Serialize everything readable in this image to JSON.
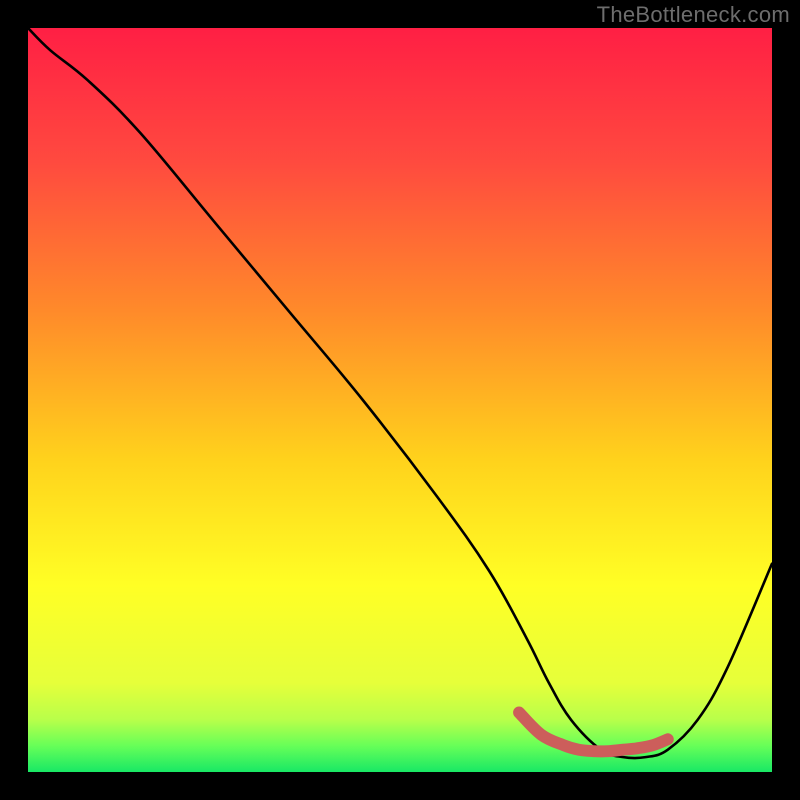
{
  "watermark": "TheBottleneck.com",
  "chart_data": {
    "type": "line",
    "title": "",
    "xlabel": "",
    "ylabel": "",
    "xlim": [
      0,
      100
    ],
    "ylim": [
      0,
      100
    ],
    "grid": false,
    "series": [
      {
        "name": "curve",
        "color": "#000000",
        "x": [
          0,
          3,
          8,
          15,
          25,
          35,
          45,
          55,
          62,
          67,
          70,
          73,
          77,
          80,
          83,
          86,
          90,
          94,
          100
        ],
        "values": [
          100,
          97,
          93,
          86,
          74,
          62,
          50,
          37,
          27,
          18,
          12,
          7,
          3,
          2,
          2,
          3,
          7,
          14,
          28
        ]
      }
    ],
    "highlight_band": {
      "comment": "red thick segment near minimum",
      "color": "#cc5e5b",
      "x": [
        66,
        69,
        72,
        74,
        76,
        78,
        80,
        82,
        84,
        86
      ],
      "values": [
        8,
        5,
        3.6,
        3.0,
        2.8,
        2.8,
        3.0,
        3.2,
        3.6,
        4.4
      ]
    },
    "gradient_stops": [
      {
        "offset": 0.0,
        "color": "#ff1f44"
      },
      {
        "offset": 0.18,
        "color": "#ff4a3f"
      },
      {
        "offset": 0.38,
        "color": "#ff8a2a"
      },
      {
        "offset": 0.58,
        "color": "#ffd21c"
      },
      {
        "offset": 0.75,
        "color": "#ffff25"
      },
      {
        "offset": 0.88,
        "color": "#e6ff3a"
      },
      {
        "offset": 0.93,
        "color": "#b8ff4a"
      },
      {
        "offset": 0.965,
        "color": "#66ff58"
      },
      {
        "offset": 1.0,
        "color": "#18e865"
      }
    ]
  }
}
